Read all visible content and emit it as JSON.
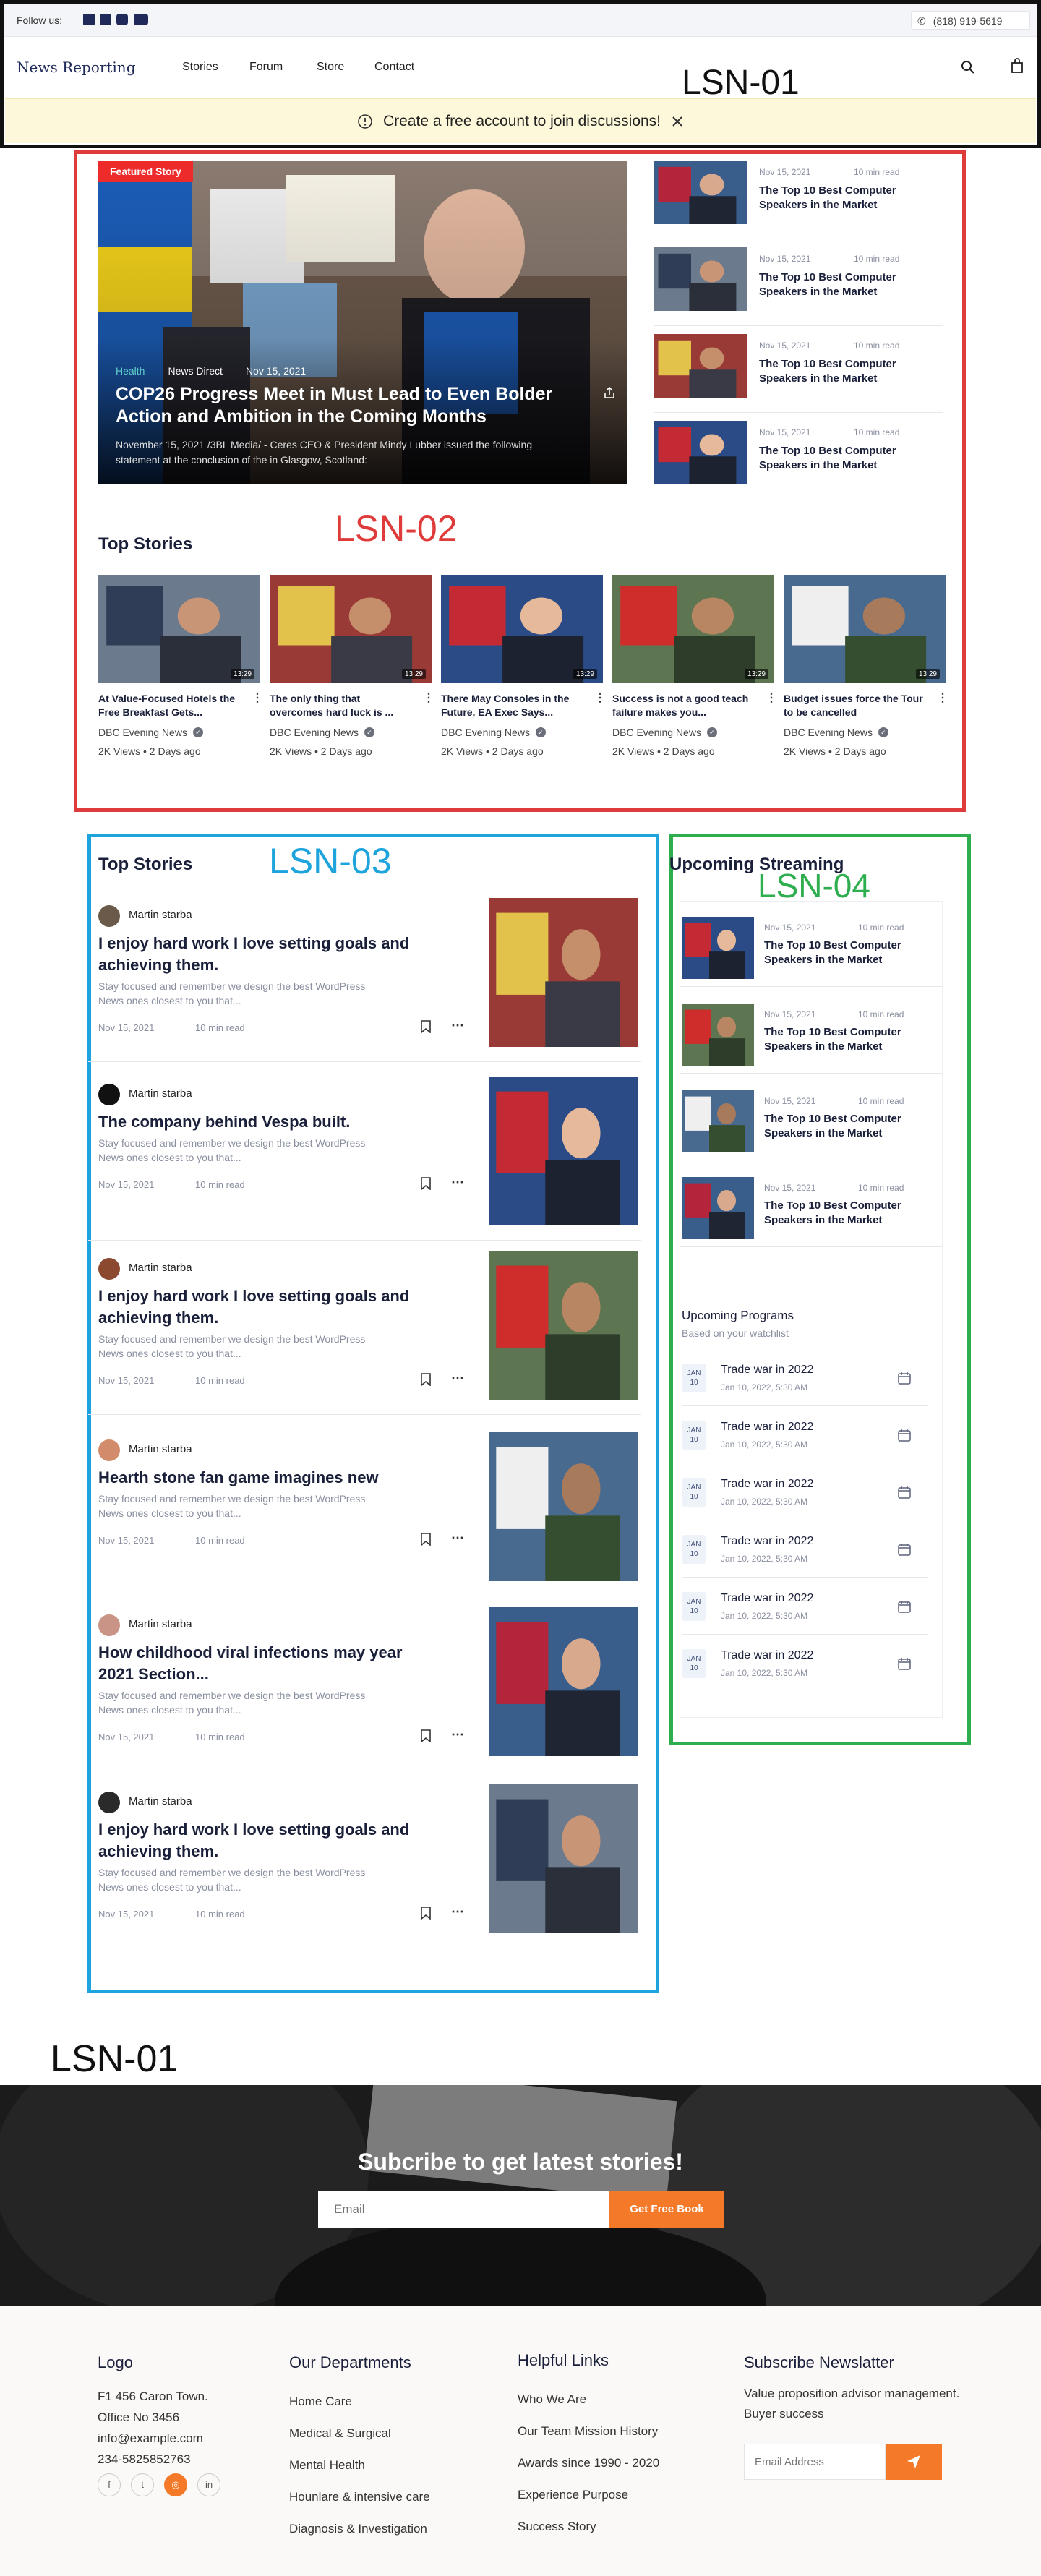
{
  "header": {
    "follow_label": "Follow us:",
    "phone": "(818) 919-5619",
    "brand": "News Reporting",
    "nav": [
      "Stories",
      "Forum",
      "Store",
      "Contact"
    ],
    "banner_text": "Create a free account to join discussions!",
    "annotation": "LSN-01"
  },
  "featured": {
    "badge": "Featured Story",
    "category": "Health",
    "source": "News Direct",
    "date": "Nov 15, 2021",
    "title": "COP26 Progress Meet in Must Lead to Even Bolder Action and Ambition in the Coming Months",
    "excerpt": "November 15, 2021 /3BL Media/ - Ceres CEO & President Mindy Lubber issued the following statement at the conclusion of the  in Glasgow, Scotland:"
  },
  "side_news": [
    {
      "date": "Nov 15, 2021",
      "read": "10 min read",
      "title": "The Top 10 Best Computer Speakers in the Market"
    },
    {
      "date": "Nov 15, 2021",
      "read": "10 min read",
      "title": "The Top 10 Best Computer Speakers in the Market"
    },
    {
      "date": "Nov 15, 2021",
      "read": "10 min read",
      "title": "The Top 10 Best Computer Speakers in the Market"
    },
    {
      "date": "Nov 15, 2021",
      "read": "10 min read",
      "title": "The Top 10 Best Computer Speakers in the Market"
    }
  ],
  "top_stories_cards": {
    "heading": "Top Stories",
    "annotation": "LSN-02",
    "items": [
      {
        "title": "At Value-Focused Hotels the Free Breakfast Gets...",
        "channel": "DBC Evening News",
        "stats": "2K Views • 2 Days ago",
        "duration": "13:29"
      },
      {
        "title": "The only thing that overcomes hard luck is ...",
        "channel": "DBC Evening News",
        "stats": "2K Views • 2 Days ago",
        "duration": "13:29"
      },
      {
        "title": "There May Consoles in the Future, EA Exec Says...",
        "channel": "DBC Evening News",
        "stats": "2K Views • 2 Days ago",
        "duration": "13:29"
      },
      {
        "title": "Success is not a good teach failure makes you...",
        "channel": "DBC Evening News",
        "stats": "2K Views • 2 Days ago",
        "duration": "13:29"
      },
      {
        "title": "Budget issues force the Tour to be cancelled",
        "channel": "DBC Evening News",
        "stats": "2K Views • 2 Days ago",
        "duration": "13:29"
      }
    ]
  },
  "articles": {
    "heading": "Top Stories",
    "annotation": "LSN-03",
    "items": [
      {
        "author": "Martin starba",
        "title": "I enjoy hard work I love setting goals and achieving them.",
        "desc": "Stay focused and remember we design the best WordPress News  ones closest to you that...",
        "date": "Nov 15, 2021",
        "read": "10 min read"
      },
      {
        "author": "Martin starba",
        "title": "The company behind Vespa built.",
        "desc": "Stay focused and remember we design the best WordPress News  ones closest to you that...",
        "date": "Nov 15, 2021",
        "read": "10 min read"
      },
      {
        "author": "Martin starba",
        "title": "I enjoy hard work I love setting goals and achieving them.",
        "desc": "Stay focused and remember we design the best WordPress News  ones closest to you that...",
        "date": "Nov 15, 2021",
        "read": "10 min read"
      },
      {
        "author": "Martin starba",
        "title": "Hearth stone fan game imagines new",
        "desc": "Stay focused and remember we design the best WordPress News  ones closest to you that...",
        "date": "Nov 15, 2021",
        "read": "10 min read"
      },
      {
        "author": "Martin starba",
        "title": "How childhood viral infections may year 2021 Section...",
        "desc": "Stay focused and remember we design the best WordPress News  ones closest to you that...",
        "date": "Nov 15, 2021",
        "read": "10 min read"
      },
      {
        "author": "Martin starba",
        "title": "I enjoy hard work I love setting goals and achieving them.",
        "desc": "Stay focused and remember we design the best WordPress News  ones closest to you that...",
        "date": "Nov 15, 2021",
        "read": "10 min read"
      }
    ]
  },
  "streaming": {
    "heading": "Upcoming Streaming",
    "annotation": "LSN-04",
    "items": [
      {
        "date": "Nov 15, 2021",
        "read": "10 min read",
        "title": "The Top 10 Best Computer Speakers in the Market"
      },
      {
        "date": "Nov 15, 2021",
        "read": "10 min read",
        "title": "The Top 10 Best Computer Speakers in the Market"
      },
      {
        "date": "Nov 15, 2021",
        "read": "10 min read",
        "title": "The Top 10 Best Computer Speakers in the Market"
      },
      {
        "date": "Nov 15, 2021",
        "read": "10 min read",
        "title": "The Top 10 Best Computer Speakers in the Market"
      }
    ]
  },
  "programs": {
    "heading": "Upcoming Programs",
    "subheading": "Based on your watchlist",
    "items": [
      {
        "month": "JAN",
        "day": "10",
        "title": "Trade war in 2022",
        "date": "Jan 10, 2022, 5:30 AM"
      },
      {
        "month": "JAN",
        "day": "10",
        "title": "Trade war in 2022",
        "date": "Jan 10, 2022, 5:30 AM"
      },
      {
        "month": "JAN",
        "day": "10",
        "title": "Trade war in 2022",
        "date": "Jan 10, 2022, 5:30 AM"
      },
      {
        "month": "JAN",
        "day": "10",
        "title": "Trade war in 2022",
        "date": "Jan 10, 2022, 5:30 AM"
      },
      {
        "month": "JAN",
        "day": "10",
        "title": "Trade war in 2022",
        "date": "Jan 10, 2022, 5:30 AM"
      },
      {
        "month": "JAN",
        "day": "10",
        "title": "Trade war in 2022",
        "date": "Jan 10, 2022, 5:30 AM"
      }
    ]
  },
  "footer_annotation": "LSN-01",
  "subscribe": {
    "title": "Subcribe to get latest stories!",
    "placeholder": "Email",
    "button": "Get Free Book"
  },
  "footer": {
    "logo": "Logo",
    "address": [
      "F1 456 Caron Town.",
      "Office No 3456",
      "info@example.com",
      "234-5825852763"
    ],
    "departments_heading": "Our Departments",
    "departments": [
      "Home Care",
      "Medical & Surgical",
      "Mental Health",
      "Hounlare & intensive care",
      "Diagnosis & Investigation"
    ],
    "links_heading": "Helpful Links",
    "links": [
      "Who We Are",
      "Our Team Mission History",
      "Awards since 1990 - 2020",
      "Experience Purpose",
      "Success Story"
    ],
    "newsletter_heading": "Subscribe Newslatter",
    "newsletter_text": "Value proposition advisor management. Buyer success",
    "newsletter_placeholder": "Email Address"
  },
  "colors": {
    "accent": "#f47a2a",
    "navy": "#1a1f3a",
    "red_box": "#e03b3b",
    "blue_box": "#1ea4dc",
    "green_box": "#2eae4e",
    "badge": "#ee2b2b"
  },
  "icons": [
    "facebook-icon",
    "twitter-icon",
    "instagram-icon",
    "youtube-icon",
    "phone-icon",
    "search-icon",
    "bag-icon",
    "info-icon",
    "close-icon",
    "share-icon",
    "more-icon",
    "verified-icon",
    "bookmark-icon",
    "calendar-icon",
    "send-icon",
    "linkedin-icon"
  ]
}
